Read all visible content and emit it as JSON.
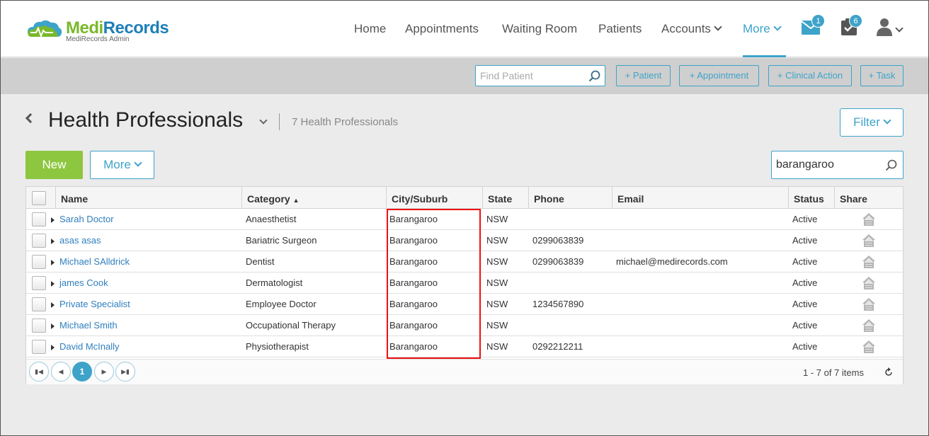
{
  "app": {
    "brand_part1": "Medi",
    "brand_part2": "Records",
    "subtitle": "MediRecords Admin"
  },
  "nav": {
    "home": "Home",
    "appointments": "Appointments",
    "waiting_room": "Waiting Room",
    "patients": "Patients",
    "accounts": "Accounts",
    "more": "More",
    "mail_badge": "1",
    "tasks_badge": "6"
  },
  "actionbar": {
    "find_patient_placeholder": "Find Patient",
    "add_patient": "+ Patient",
    "add_appointment": "+ Appointment",
    "add_clinical_action": "+ Clinical Action",
    "add_task": "+ Task"
  },
  "page": {
    "title": "Health Professionals",
    "count_label": "7 Health Professionals",
    "filter_label": "Filter",
    "new_label": "New",
    "more_label": "More",
    "search_value": "barangaroo"
  },
  "grid": {
    "columns": [
      "Name",
      "Category",
      "City/Suburb",
      "State",
      "Phone",
      "Email",
      "Status",
      "Share"
    ],
    "sort_indicator": "▲",
    "rows": [
      {
        "name": "Sarah Doctor",
        "category": "Anaesthetist",
        "city": "Barangaroo",
        "state": "NSW",
        "phone": "",
        "email": "",
        "status": "Active"
      },
      {
        "name": "asas asas",
        "category": "Bariatric Surgeon",
        "city": "Barangaroo",
        "state": "NSW",
        "phone": "0299063839",
        "email": "",
        "status": "Active"
      },
      {
        "name": "Michael SAlldrick",
        "category": "Dentist",
        "city": "Barangaroo",
        "state": "NSW",
        "phone": "0299063839",
        "email": "michael@medirecords.com",
        "status": "Active"
      },
      {
        "name": "james Cook",
        "category": "Dermatologist",
        "city": "Barangaroo",
        "state": "NSW",
        "phone": "",
        "email": "",
        "status": "Active"
      },
      {
        "name": "Private Specialist",
        "category": "Employee Doctor",
        "city": "Barangaroo",
        "state": "NSW",
        "phone": "1234567890",
        "email": "",
        "status": "Active"
      },
      {
        "name": "Michael Smith",
        "category": "Occupational Therapy",
        "city": "Barangaroo",
        "state": "NSW",
        "phone": "",
        "email": "",
        "status": "Active"
      },
      {
        "name": "David McInally",
        "category": "Physiotherapist",
        "city": "Barangaroo",
        "state": "NSW",
        "phone": "0292212211",
        "email": "",
        "status": "Active"
      }
    ],
    "pager": {
      "current_page": "1",
      "info": "1 - 7 of 7 items"
    }
  },
  "colors": {
    "accent": "#3ea3c9",
    "brand_green": "#79b929",
    "brand_blue": "#1e7fb8",
    "new_button": "#8dc63f",
    "link": "#2f7fbf",
    "highlight_box": "#ee1111"
  }
}
